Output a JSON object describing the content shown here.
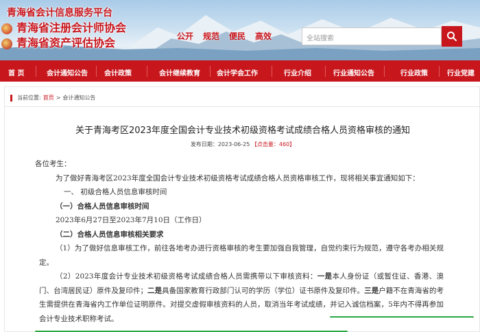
{
  "header": {
    "titles": [
      "青海省会计信息服务平台",
      "青海省注册会计师协会",
      "青海省资产评估协会"
    ],
    "slogans": [
      "公开",
      "规范",
      "便民",
      "高效"
    ],
    "search": {
      "placeholder": "全站搜索"
    }
  },
  "nav": {
    "items": [
      "首 页",
      "会计通知公告",
      "会计政策",
      "会计继续教育",
      "会计学会工作",
      "行业介绍",
      "行业通知公告",
      "行业政策",
      "行业党建"
    ]
  },
  "breadcrumb": {
    "label": "当前位置:",
    "home": "首页",
    "sep": ">",
    "current": "会计通知公告"
  },
  "article": {
    "title": "关于青海考区2023年度全国会计专业技术初级资格考试成绩合格人员资格审核的通知",
    "meta": {
      "date_label": "发布日期：",
      "date": "2023-06-25",
      "hits_open": "【点击量：",
      "hits": "460",
      "hits_close": "】"
    },
    "salutation": "各位考生：",
    "intro": "为了做好青海考区2023年度全国会计专业技术初级资格考试成绩合格人员资格审核工作，现将相关事宜通知如下：",
    "h1": "一、  初级合格人员信息审核时间",
    "h1_1": "（一）合格人员信息审核时间",
    "time": "2023年6月27日至2023年7月10日（工作日）",
    "h1_2": "（二）合格人员信息审核相关要求",
    "p1": "（1）为了做好信息审核工作，前往各地考办进行资格审核的考生要加强自我管理，自觉约束行为规范，遵守各考办相关规定。",
    "p2_a": "（2）2023年度会计专业技术初级资格考试成绩合格人员需携带以下审核资料：",
    "p2_b1": "一是",
    "p2_c": "本人身份证（或暂住证、香港、澳门、台湾居民证）原件及复印件；",
    "p2_b2": "二是",
    "p2_d": "具备国家教育行政部门认可的学历（学位）证书原件及复印件。",
    "p2_b3": "三是",
    "p2_e": "户籍不在青海省的考生需提供在青海省内工作单位证明原件。对提交虚假审核资料的人员，取消当年考试成绩，并记入诚信档案，5年内不得再参加会计专业技术职称考试。"
  },
  "colors": {
    "brand_red": "#c8161d",
    "highlight_green": "#2aa844"
  }
}
